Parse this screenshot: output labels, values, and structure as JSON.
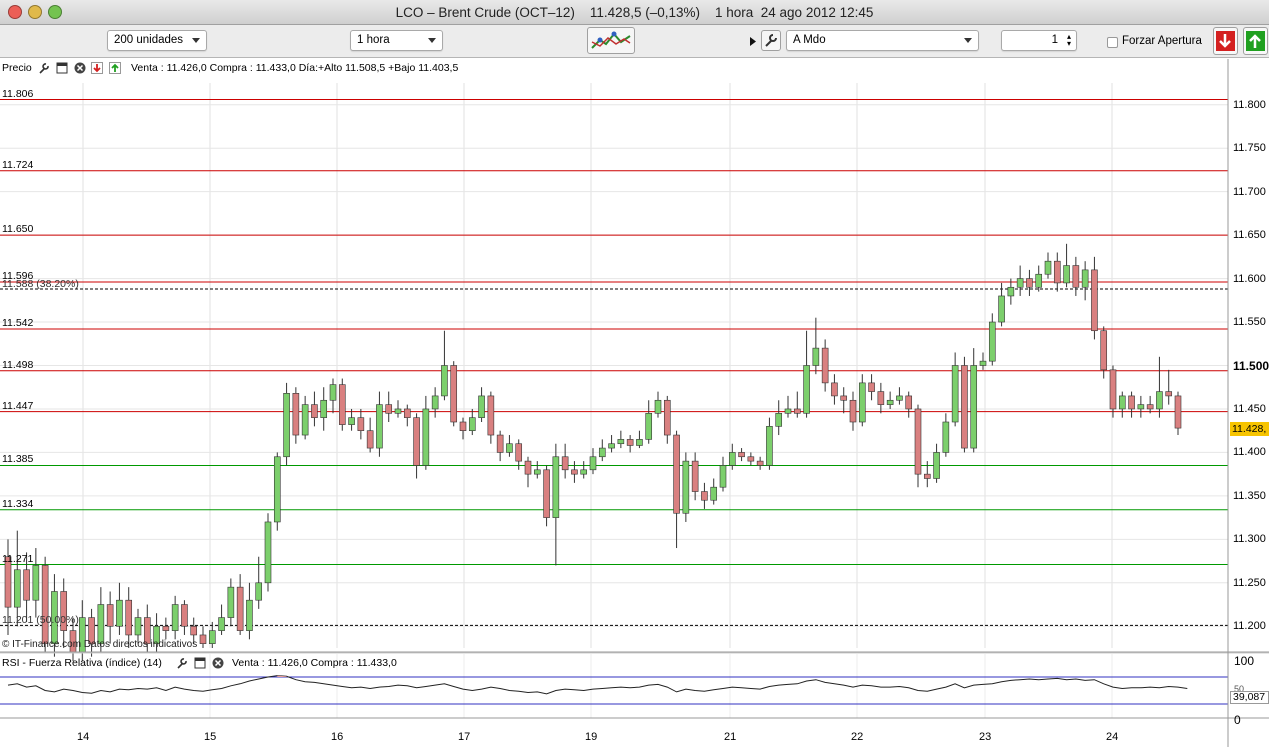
{
  "window": {
    "title": "LCO – Brent Crude (OCT–12)    11.428,5 (–0,13%)    1 hora  24 ago 2012 12:45"
  },
  "toolbar": {
    "units": "200 unidades",
    "interval": "1 hora",
    "order_type": "A Mdo",
    "quantity": "1",
    "force_open": "Forzar Apertura"
  },
  "price_panel": {
    "title": "Precio",
    "info": "Venta : 11.426,0 Compra : 11.433,0 Día:+Alto 11.508,5 +Bajo 11.403,5"
  },
  "rsi_panel": {
    "title": "RSI - Fuerza Relativa (índice) (14)",
    "info": "Venta : 11.426,0 Compra : 11.433,0",
    "upper": "100",
    "lower": "0",
    "mid": "50",
    "value": "39,087"
  },
  "watermark": "© IT-Finance.com     Datos directos indicativos",
  "current_price": "11.428,",
  "chart_data": {
    "type": "candlestick",
    "ylim": [
      11175,
      11825
    ],
    "y_ticks": [
      "11.800",
      "11.750",
      "11.700",
      "11.650",
      "11.600",
      "11.550",
      "11.500",
      "11.450",
      "11.400",
      "11.350",
      "11.300",
      "11.250",
      "11.200"
    ],
    "x_labels": [
      "14",
      "15",
      "16",
      "17",
      "19",
      "21",
      "22",
      "23",
      "24"
    ],
    "levels": [
      {
        "label": "11.806",
        "value": 11806,
        "color": "#cc0000"
      },
      {
        "label": "11.724",
        "value": 11724,
        "color": "#cc0000"
      },
      {
        "label": "11.650",
        "value": 11650,
        "color": "#cc0000"
      },
      {
        "label": "11.596",
        "value": 11596,
        "color": "#cc0000"
      },
      {
        "label": "11.542",
        "value": 11542,
        "color": "#cc0000"
      },
      {
        "label": "11.498",
        "value": 11494,
        "color": "#cc0000"
      },
      {
        "label": "11.447",
        "value": 11447,
        "color": "#cc0000"
      },
      {
        "label": "11.385",
        "value": 11385,
        "color": "#009900"
      },
      {
        "label": "11.334",
        "value": 11334,
        "color": "#009900"
      },
      {
        "label": "11.271",
        "value": 11271,
        "color": "#009900"
      }
    ],
    "fib_lines": [
      {
        "label": "11.588 (38.20%)",
        "value": 11588
      },
      {
        "label": "11.201 (50.00%)",
        "value": 11201
      }
    ],
    "candles": [
      [
        11280,
        11222,
        11300,
        11190
      ],
      [
        11222,
        11265,
        11310,
        11200
      ],
      [
        11265,
        11230,
        11285,
        11205
      ],
      [
        11230,
        11270,
        11290,
        11210
      ],
      [
        11270,
        11180,
        11280,
        11170
      ],
      [
        11180,
        11240,
        11260,
        11165
      ],
      [
        11240,
        11195,
        11255,
        11175
      ],
      [
        11195,
        11170,
        11210,
        11160
      ],
      [
        11170,
        11210,
        11230,
        11160
      ],
      [
        11210,
        11180,
        11220,
        11165
      ],
      [
        11180,
        11225,
        11245,
        11170
      ],
      [
        11225,
        11200,
        11240,
        11180
      ],
      [
        11200,
        11230,
        11250,
        11190
      ],
      [
        11230,
        11190,
        11245,
        11175
      ],
      [
        11190,
        11210,
        11220,
        11180
      ],
      [
        11210,
        11180,
        11225,
        11170
      ],
      [
        11180,
        11200,
        11215,
        11170
      ],
      [
        11200,
        11195,
        11210,
        11185
      ],
      [
        11195,
        11225,
        11235,
        11185
      ],
      [
        11225,
        11200,
        11230,
        11190
      ],
      [
        11200,
        11190,
        11210,
        11180
      ],
      [
        11190,
        11180,
        11200,
        11175
      ],
      [
        11180,
        11195,
        11205,
        11175
      ],
      [
        11195,
        11210,
        11225,
        11190
      ],
      [
        11210,
        11245,
        11255,
        11200
      ],
      [
        11245,
        11195,
        11260,
        11190
      ],
      [
        11195,
        11230,
        11250,
        11185
      ],
      [
        11230,
        11250,
        11280,
        11220
      ],
      [
        11250,
        11320,
        11330,
        11240
      ],
      [
        11320,
        11395,
        11400,
        11310
      ],
      [
        11395,
        11468,
        11480,
        11385
      ],
      [
        11468,
        11420,
        11475,
        11410
      ],
      [
        11420,
        11455,
        11465,
        11415
      ],
      [
        11455,
        11440,
        11470,
        11430
      ],
      [
        11440,
        11460,
        11475,
        11425
      ],
      [
        11460,
        11478,
        11485,
        11445
      ],
      [
        11478,
        11432,
        11485,
        11425
      ],
      [
        11432,
        11440,
        11450,
        11425
      ],
      [
        11440,
        11425,
        11450,
        11415
      ],
      [
        11425,
        11405,
        11440,
        11400
      ],
      [
        11405,
        11455,
        11470,
        11395
      ],
      [
        11455,
        11445,
        11470,
        11435
      ],
      [
        11445,
        11450,
        11460,
        11440
      ],
      [
        11450,
        11440,
        11455,
        11430
      ],
      [
        11440,
        11385,
        11445,
        11370
      ],
      [
        11385,
        11450,
        11465,
        11380
      ],
      [
        11450,
        11465,
        11475,
        11440
      ],
      [
        11465,
        11500,
        11540,
        11460
      ],
      [
        11500,
        11435,
        11505,
        11430
      ],
      [
        11435,
        11425,
        11440,
        11415
      ],
      [
        11425,
        11440,
        11450,
        11420
      ],
      [
        11440,
        11465,
        11475,
        11435
      ],
      [
        11465,
        11420,
        11470,
        11410
      ],
      [
        11420,
        11400,
        11425,
        11390
      ],
      [
        11400,
        11410,
        11420,
        11395
      ],
      [
        11410,
        11390,
        11415,
        11380
      ],
      [
        11390,
        11375,
        11395,
        11360
      ],
      [
        11375,
        11380,
        11390,
        11370
      ],
      [
        11380,
        11325,
        11385,
        11315
      ],
      [
        11325,
        11395,
        11410,
        11270
      ],
      [
        11395,
        11380,
        11410,
        11370
      ],
      [
        11380,
        11375,
        11390,
        11365
      ],
      [
        11375,
        11380,
        11390,
        11370
      ],
      [
        11380,
        11395,
        11405,
        11375
      ],
      [
        11395,
        11405,
        11415,
        11390
      ],
      [
        11405,
        11410,
        11420,
        11400
      ],
      [
        11410,
        11415,
        11425,
        11405
      ],
      [
        11415,
        11408,
        11420,
        11400
      ],
      [
        11408,
        11415,
        11425,
        11405
      ],
      [
        11415,
        11445,
        11460,
        11410
      ],
      [
        11445,
        11460,
        11470,
        11440
      ],
      [
        11460,
        11420,
        11465,
        11410
      ],
      [
        11420,
        11330,
        11425,
        11290
      ],
      [
        11330,
        11390,
        11400,
        11320
      ],
      [
        11390,
        11355,
        11400,
        11345
      ],
      [
        11355,
        11345,
        11365,
        11335
      ],
      [
        11345,
        11360,
        11370,
        11340
      ],
      [
        11360,
        11385,
        11395,
        11355
      ],
      [
        11385,
        11400,
        11410,
        11380
      ],
      [
        11400,
        11395,
        11405,
        11390
      ],
      [
        11395,
        11390,
        11400,
        11385
      ],
      [
        11390,
        11385,
        11395,
        11380
      ],
      [
        11385,
        11430,
        11440,
        11380
      ],
      [
        11430,
        11445,
        11460,
        11420
      ],
      [
        11445,
        11450,
        11465,
        11440
      ],
      [
        11450,
        11445,
        11470,
        11440
      ],
      [
        11445,
        11500,
        11540,
        11440
      ],
      [
        11500,
        11520,
        11555,
        11490
      ],
      [
        11520,
        11480,
        11530,
        11470
      ],
      [
        11480,
        11465,
        11490,
        11455
      ],
      [
        11465,
        11460,
        11475,
        11445
      ],
      [
        11460,
        11435,
        11470,
        11425
      ],
      [
        11435,
        11480,
        11490,
        11430
      ],
      [
        11480,
        11470,
        11490,
        11460
      ],
      [
        11470,
        11455,
        11480,
        11445
      ],
      [
        11455,
        11460,
        11470,
        11450
      ],
      [
        11460,
        11465,
        11475,
        11455
      ],
      [
        11465,
        11450,
        11470,
        11440
      ],
      [
        11450,
        11375,
        11455,
        11360
      ],
      [
        11375,
        11370,
        11390,
        11360
      ],
      [
        11370,
        11400,
        11410,
        11365
      ],
      [
        11400,
        11435,
        11445,
        11395
      ],
      [
        11435,
        11500,
        11515,
        11430
      ],
      [
        11500,
        11405,
        11510,
        11400
      ],
      [
        11405,
        11500,
        11520,
        11400
      ],
      [
        11500,
        11505,
        11515,
        11495
      ],
      [
        11505,
        11550,
        11560,
        11500
      ],
      [
        11550,
        11580,
        11595,
        11545
      ],
      [
        11580,
        11590,
        11600,
        11570
      ],
      [
        11590,
        11600,
        11615,
        11580
      ],
      [
        11600,
        11590,
        11610,
        11580
      ],
      [
        11590,
        11605,
        11615,
        11585
      ],
      [
        11605,
        11620,
        11630,
        11600
      ],
      [
        11620,
        11595,
        11630,
        11585
      ],
      [
        11595,
        11615,
        11640,
        11590
      ],
      [
        11615,
        11590,
        11625,
        11580
      ],
      [
        11590,
        11610,
        11620,
        11575
      ],
      [
        11610,
        11540,
        11625,
        11530
      ],
      [
        11540,
        11495,
        11545,
        11485
      ],
      [
        11495,
        11450,
        11500,
        11440
      ],
      [
        11450,
        11465,
        11470,
        11440
      ],
      [
        11465,
        11450,
        11470,
        11440
      ],
      [
        11450,
        11455,
        11465,
        11440
      ],
      [
        11455,
        11450,
        11465,
        11445
      ],
      [
        11450,
        11470,
        11510,
        11440
      ],
      [
        11470,
        11465,
        11495,
        11455
      ],
      [
        11465,
        11428,
        11470,
        11420
      ]
    ],
    "rsi": [
      58,
      60,
      55,
      57,
      50,
      48,
      52,
      50,
      47,
      46,
      50,
      48,
      52,
      51,
      53,
      52,
      54,
      50,
      55,
      52,
      50,
      49,
      51,
      53,
      57,
      60,
      64,
      67,
      70,
      72,
      71,
      66,
      63,
      62,
      60,
      58,
      56,
      54,
      55,
      53,
      55,
      56,
      58,
      57,
      54,
      56,
      58,
      60,
      56,
      52,
      50,
      52,
      55,
      53,
      50,
      49,
      47,
      48,
      45,
      50,
      52,
      51,
      50,
      52,
      53,
      54,
      55,
      54,
      55,
      58,
      59,
      55,
      48,
      52,
      50,
      49,
      51,
      53,
      55,
      54,
      53,
      52,
      56,
      58,
      59,
      60,
      64,
      66,
      62,
      60,
      58,
      55,
      58,
      57,
      55,
      55,
      56,
      54,
      50,
      49,
      52,
      55,
      60,
      54,
      58,
      59,
      60,
      63,
      65,
      66,
      67,
      66,
      67,
      68,
      66,
      67,
      65,
      66,
      60,
      55,
      53,
      54,
      54,
      55,
      54,
      56,
      55,
      53
    ]
  }
}
